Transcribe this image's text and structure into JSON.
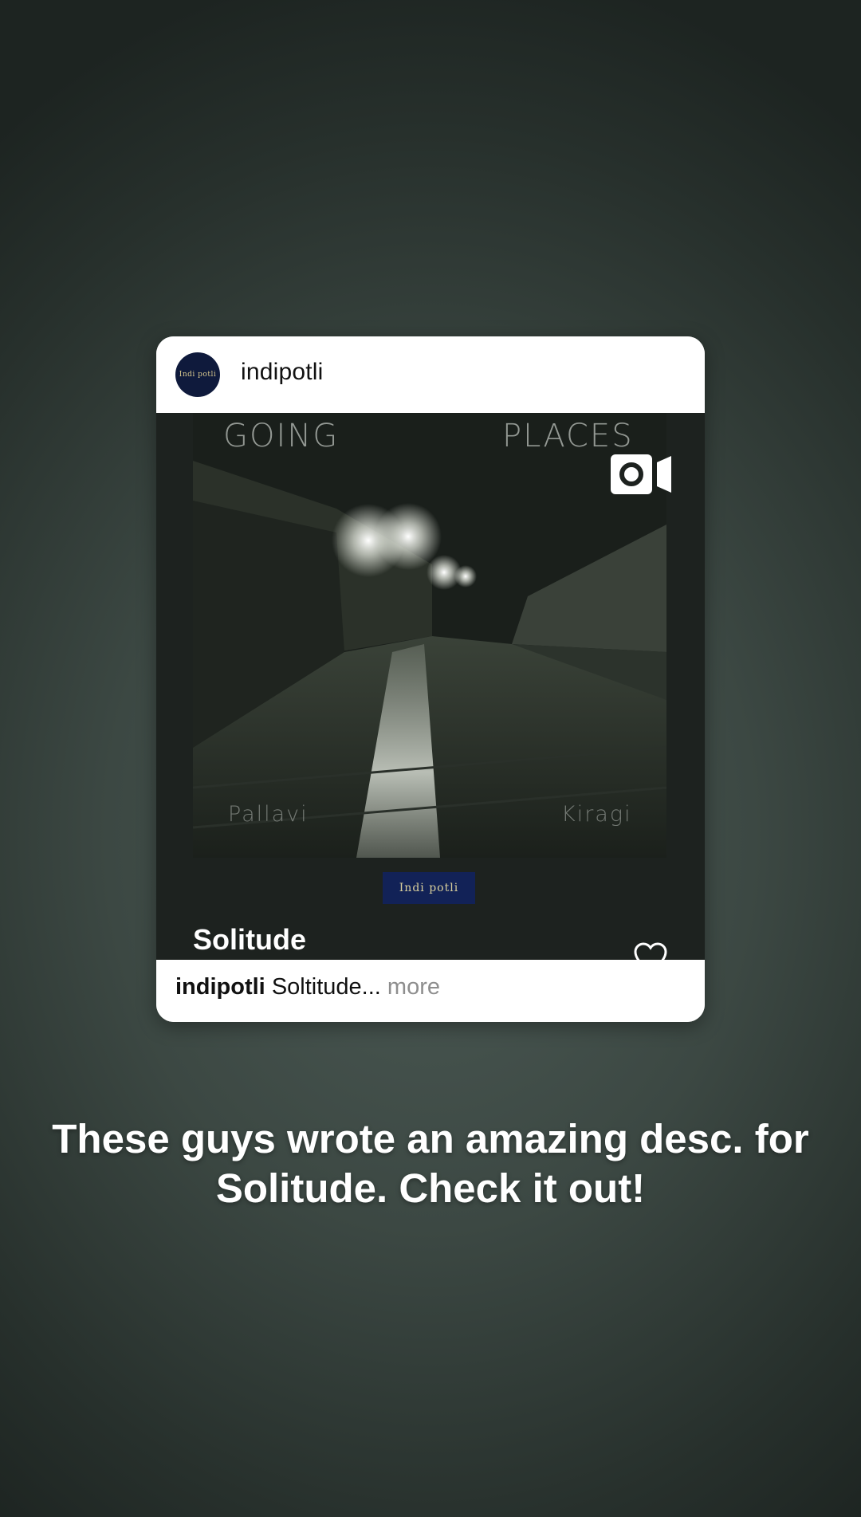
{
  "post": {
    "username": "indipotli",
    "avatar_text": "Indi potli",
    "cover": {
      "title_left": "GOING",
      "title_right": "PLACES",
      "artist_left": "Pallavi",
      "artist_right": "Kiragi"
    },
    "badge_text": "Indi potli",
    "track_title": "Solitude",
    "caption": {
      "user": "indipotli",
      "text": "Soltitude",
      "ellipsis": "...",
      "more": "more"
    }
  },
  "story": {
    "text": "These guys wrote an amazing desc. for Solitude. Check it out!"
  },
  "icons": [
    "video-camera-icon",
    "heart-icon"
  ],
  "colors": {
    "avatar_bg": "#0f1a3c",
    "badge_bg": "#122257",
    "background": "#3c4843"
  }
}
